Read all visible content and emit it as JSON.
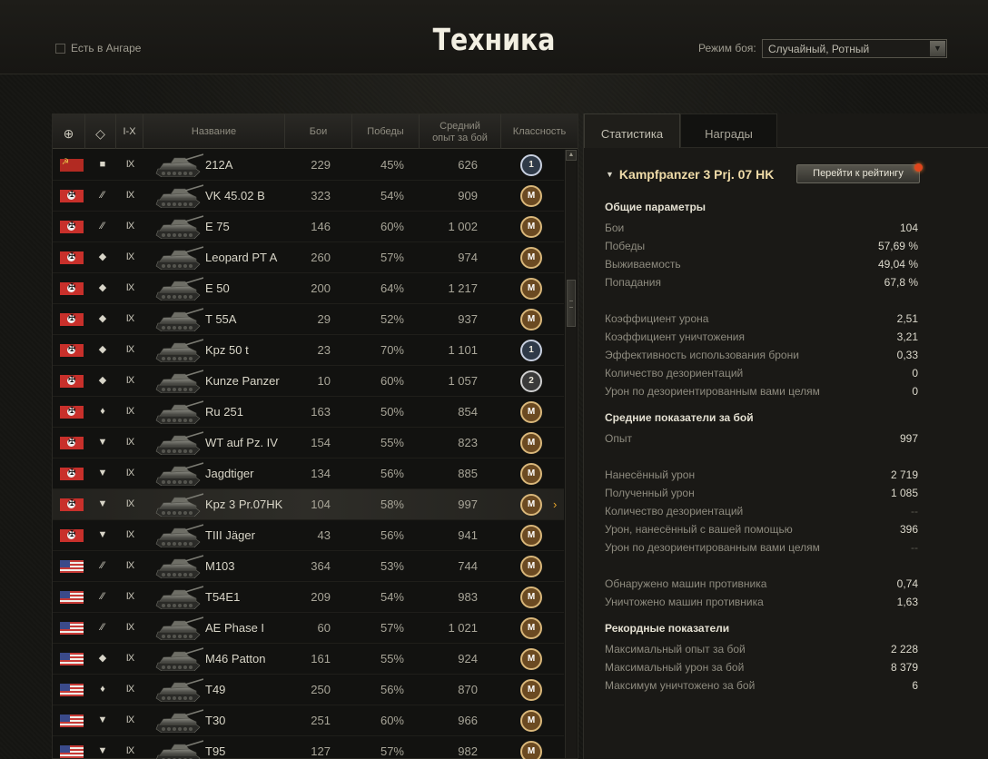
{
  "header": {
    "title": "Техника",
    "in_hangar_label": "Есть в Ангаре",
    "battle_mode_label": "Режим боя:",
    "battle_mode_value": "Случайный, Ротный"
  },
  "table": {
    "columns": {
      "tier": "I-X",
      "name": "Название",
      "battles": "Бои",
      "wins": "Победы",
      "avg_exp_line1": "Средний",
      "avg_exp_line2": "опыт за бой",
      "mastery": "Классность"
    },
    "rows": [
      {
        "nation": "su",
        "cls": "■",
        "tier": "IX",
        "name": "212A",
        "battles": "229",
        "wins": "45%",
        "exp": "626",
        "badge": "1"
      },
      {
        "nation": "de",
        "cls": "⁄⁄",
        "tier": "IX",
        "name": "VK 45.02 B",
        "battles": "323",
        "wins": "54%",
        "exp": "909",
        "badge": "M"
      },
      {
        "nation": "de",
        "cls": "⁄⁄",
        "tier": "IX",
        "name": "E 75",
        "battles": "146",
        "wins": "60%",
        "exp": "1 002",
        "badge": "M"
      },
      {
        "nation": "de",
        "cls": "◆",
        "tier": "IX",
        "name": "Leopard PT A",
        "battles": "260",
        "wins": "57%",
        "exp": "974",
        "badge": "M"
      },
      {
        "nation": "de",
        "cls": "◆",
        "tier": "IX",
        "name": "E 50",
        "battles": "200",
        "wins": "64%",
        "exp": "1 217",
        "badge": "M"
      },
      {
        "nation": "de",
        "cls": "◆",
        "tier": "IX",
        "name": "T 55A",
        "battles": "29",
        "wins": "52%",
        "exp": "937",
        "badge": "M"
      },
      {
        "nation": "de",
        "cls": "◆",
        "tier": "IX",
        "name": "Kpz 50 t",
        "battles": "23",
        "wins": "70%",
        "exp": "1 101",
        "badge": "1"
      },
      {
        "nation": "de",
        "cls": "◆",
        "tier": "IX",
        "name": "Kunze Panzer",
        "battles": "10",
        "wins": "60%",
        "exp": "1 057",
        "badge": "2"
      },
      {
        "nation": "de",
        "cls": "♦",
        "tier": "IX",
        "name": "Ru 251",
        "battles": "163",
        "wins": "50%",
        "exp": "854",
        "badge": "M"
      },
      {
        "nation": "de",
        "cls": "▼",
        "tier": "IX",
        "name": "WT auf Pz. IV",
        "battles": "154",
        "wins": "55%",
        "exp": "823",
        "badge": "M"
      },
      {
        "nation": "de",
        "cls": "▼",
        "tier": "IX",
        "name": "Jagdtiger",
        "battles": "134",
        "wins": "56%",
        "exp": "885",
        "badge": "M"
      },
      {
        "nation": "de",
        "cls": "▼",
        "tier": "IX",
        "name": "Kpz 3 Pr.07HK",
        "battles": "104",
        "wins": "58%",
        "exp": "997",
        "badge": "M",
        "selected": true
      },
      {
        "nation": "de",
        "cls": "▼",
        "tier": "IX",
        "name": "TIII Jäger",
        "battles": "43",
        "wins": "56%",
        "exp": "941",
        "badge": "M"
      },
      {
        "nation": "us",
        "cls": "⁄⁄",
        "tier": "IX",
        "name": "M103",
        "battles": "364",
        "wins": "53%",
        "exp": "744",
        "badge": "M"
      },
      {
        "nation": "us",
        "cls": "⁄⁄",
        "tier": "IX",
        "name": "T54E1",
        "battles": "209",
        "wins": "54%",
        "exp": "983",
        "badge": "M"
      },
      {
        "nation": "us",
        "cls": "⁄⁄",
        "tier": "IX",
        "name": "AE Phase I",
        "battles": "60",
        "wins": "57%",
        "exp": "1 021",
        "badge": "M"
      },
      {
        "nation": "us",
        "cls": "◆",
        "tier": "IX",
        "name": "M46 Patton",
        "battles": "161",
        "wins": "55%",
        "exp": "924",
        "badge": "M"
      },
      {
        "nation": "us",
        "cls": "♦",
        "tier": "IX",
        "name": "T49",
        "battles": "250",
        "wins": "56%",
        "exp": "870",
        "badge": "M"
      },
      {
        "nation": "us",
        "cls": "▼",
        "tier": "IX",
        "name": "T30",
        "battles": "251",
        "wins": "60%",
        "exp": "966",
        "badge": "M"
      },
      {
        "nation": "us",
        "cls": "▼",
        "tier": "IX",
        "name": "T95",
        "battles": "127",
        "wins": "57%",
        "exp": "982",
        "badge": "M"
      }
    ]
  },
  "details": {
    "tabs": [
      "Статистика",
      "Награды"
    ],
    "tank_title": "Kampfpanzer 3 Prj. 07 HK",
    "rating_button": "Перейти к рейтингу",
    "sections": [
      {
        "title": "Общие параметры",
        "rows": [
          {
            "label": "Бои",
            "value": "104"
          },
          {
            "label": "Победы",
            "value": "57,69 %"
          },
          {
            "label": "Выживаемость",
            "value": "49,04 %"
          },
          {
            "label": "Попадания",
            "value": "67,8 %"
          },
          {
            "label": "",
            "value": ""
          },
          {
            "label": "Коэффициент урона",
            "value": "2,51"
          },
          {
            "label": "Коэффициент уничтожения",
            "value": "3,21"
          },
          {
            "label": "Эффективность использования брони",
            "value": "0,33"
          },
          {
            "label": "Количество дезориентаций",
            "value": "0"
          },
          {
            "label": "Урон по дезориентированным вами целям",
            "value": "0"
          }
        ]
      },
      {
        "title": "Средние показатели за бой",
        "rows": [
          {
            "label": "Опыт",
            "value": "997"
          },
          {
            "label": "",
            "value": ""
          },
          {
            "label": "Нанесённый урон",
            "value": "2 719"
          },
          {
            "label": "Полученный урон",
            "value": "1 085"
          },
          {
            "label": "Количество дезориентаций",
            "value": "--",
            "dim": true
          },
          {
            "label": "Урон, нанесённый с вашей помощью",
            "value": "396"
          },
          {
            "label": "Урон по дезориентированным вами целям",
            "value": "--",
            "dim": true
          },
          {
            "label": "",
            "value": ""
          },
          {
            "label": "Обнаружено машин противника",
            "value": "0,74"
          },
          {
            "label": "Уничтожено машин противника",
            "value": "1,63"
          }
        ]
      },
      {
        "title": "Рекордные показатели",
        "rows": [
          {
            "label": "Максимальный опыт за бой",
            "value": "2 228"
          },
          {
            "label": "Максимальный урон за бой",
            "value": "8 379"
          },
          {
            "label": "Максимум уничтожено за бой",
            "value": "6"
          }
        ]
      }
    ]
  }
}
